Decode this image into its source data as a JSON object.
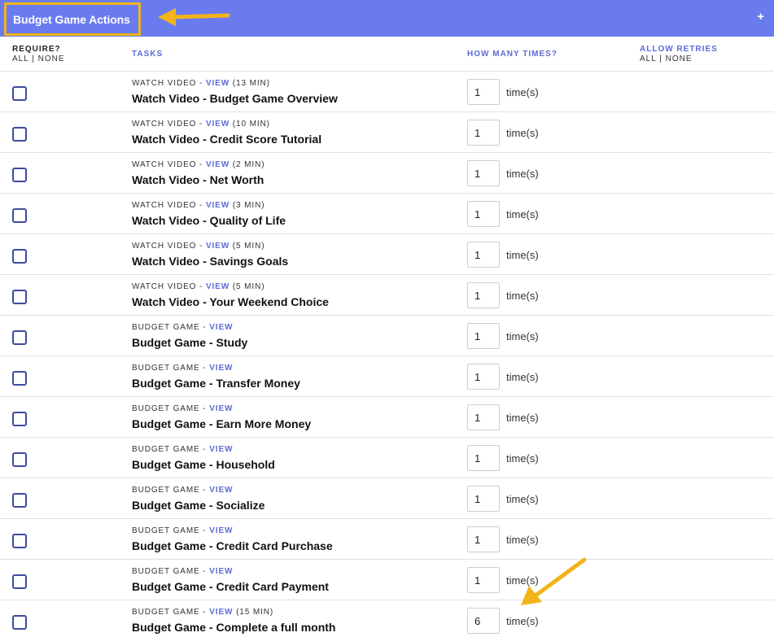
{
  "header": {
    "title": "Budget Game Actions",
    "plus_label": "+",
    "bar_color": "#6a7bf0",
    "highlight_color": "#f2b31b"
  },
  "columns": {
    "require": "REQUIRE?",
    "require_all": "ALL",
    "require_sep": "|",
    "require_none": "NONE",
    "tasks": "TASKS",
    "how_many": "HOW MANY TIMES?",
    "allow_retries": "ALLOW RETRIES",
    "retries_all": "ALL",
    "retries_sep": "|",
    "retries_none": "NONE"
  },
  "rows": [
    {
      "type": "WATCH VIDEO",
      "sep": " - ",
      "view": "VIEW",
      "duration": " (13 MIN)",
      "name": "Watch Video - Budget Game Overview",
      "times": "1",
      "unit": "time(s)"
    },
    {
      "type": "WATCH VIDEO",
      "sep": " - ",
      "view": "VIEW",
      "duration": " (10 MIN)",
      "name": "Watch Video - Credit Score Tutorial",
      "times": "1",
      "unit": "time(s)"
    },
    {
      "type": "WATCH VIDEO",
      "sep": " - ",
      "view": "VIEW",
      "duration": " (2 MIN)",
      "name": "Watch Video - Net Worth",
      "times": "1",
      "unit": "time(s)"
    },
    {
      "type": "WATCH VIDEO",
      "sep": " - ",
      "view": "VIEW",
      "duration": " (3 MIN)",
      "name": "Watch Video - Quality of Life",
      "times": "1",
      "unit": "time(s)"
    },
    {
      "type": "WATCH VIDEO",
      "sep": " - ",
      "view": "VIEW",
      "duration": " (5 MIN)",
      "name": "Watch Video - Savings Goals",
      "times": "1",
      "unit": "time(s)"
    },
    {
      "type": "WATCH VIDEO",
      "sep": " - ",
      "view": "VIEW",
      "duration": " (5 MIN)",
      "name": "Watch Video - Your Weekend Choice",
      "times": "1",
      "unit": "time(s)"
    },
    {
      "type": "BUDGET GAME",
      "sep": " - ",
      "view": "VIEW",
      "duration": "",
      "name": "Budget Game - Study",
      "times": "1",
      "unit": "time(s)"
    },
    {
      "type": "BUDGET GAME",
      "sep": " - ",
      "view": "VIEW",
      "duration": "",
      "name": "Budget Game - Transfer Money",
      "times": "1",
      "unit": "time(s)"
    },
    {
      "type": "BUDGET GAME",
      "sep": " - ",
      "view": "VIEW",
      "duration": "",
      "name": "Budget Game - Earn More Money",
      "times": "1",
      "unit": "time(s)"
    },
    {
      "type": "BUDGET GAME",
      "sep": " - ",
      "view": "VIEW",
      "duration": "",
      "name": "Budget Game - Household",
      "times": "1",
      "unit": "time(s)"
    },
    {
      "type": "BUDGET GAME",
      "sep": " - ",
      "view": "VIEW",
      "duration": "",
      "name": "Budget Game - Socialize",
      "times": "1",
      "unit": "time(s)"
    },
    {
      "type": "BUDGET GAME",
      "sep": " - ",
      "view": "VIEW",
      "duration": "",
      "name": "Budget Game - Credit Card Purchase",
      "times": "1",
      "unit": "time(s)"
    },
    {
      "type": "BUDGET GAME",
      "sep": " - ",
      "view": "VIEW",
      "duration": "",
      "name": "Budget Game - Credit Card Payment",
      "times": "1",
      "unit": "time(s)"
    },
    {
      "type": "BUDGET GAME",
      "sep": " - ",
      "view": "VIEW",
      "duration": " (15 MIN)",
      "name": "Budget Game - Complete a full month",
      "times": "6",
      "unit": "time(s)"
    }
  ]
}
